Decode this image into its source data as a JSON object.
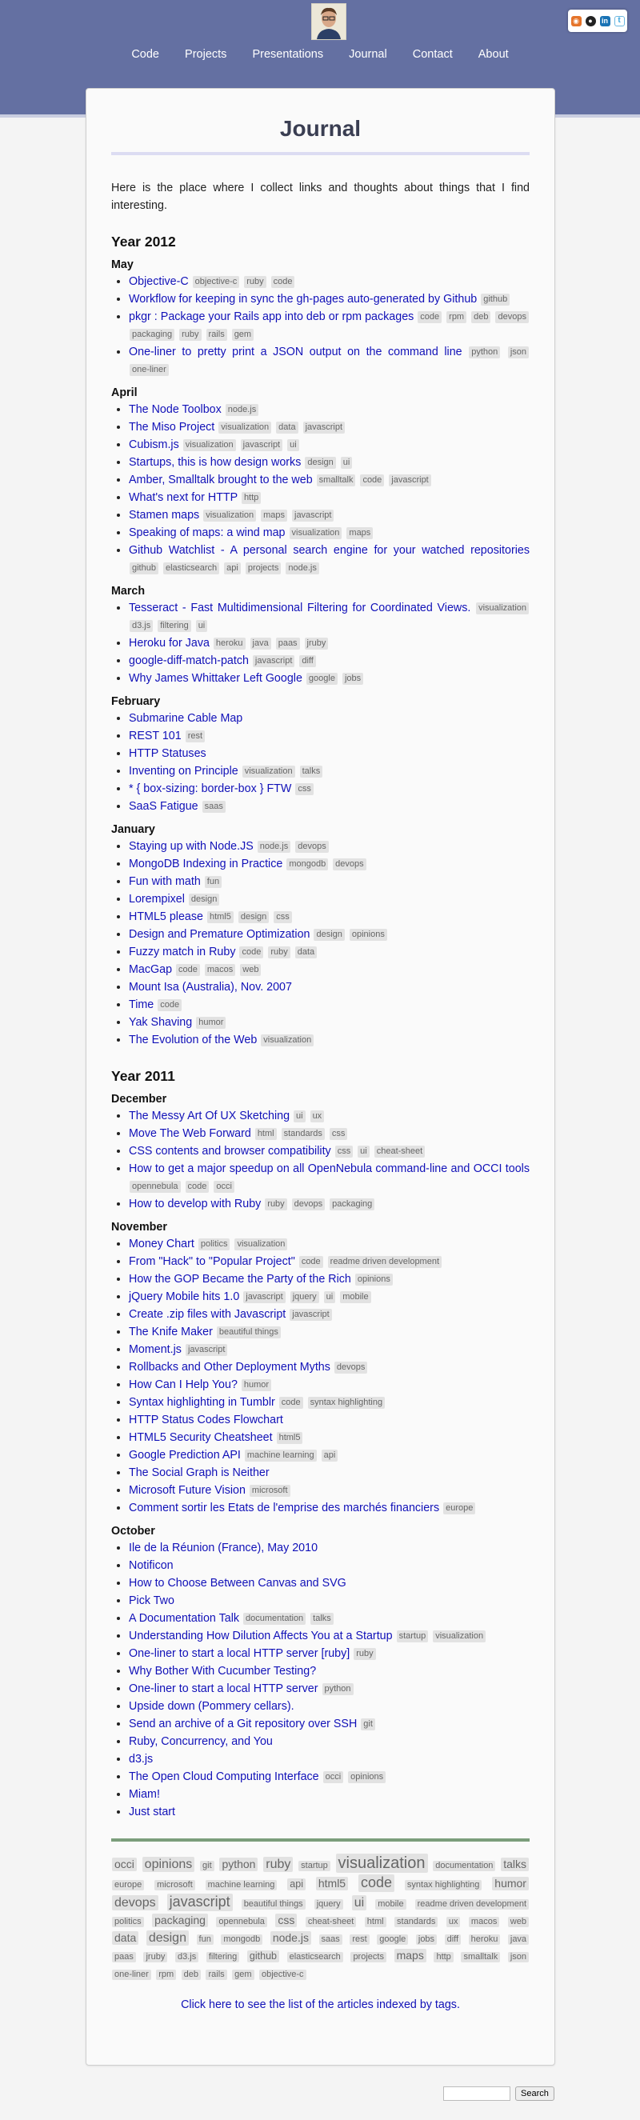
{
  "nav": [
    "Code",
    "Projects",
    "Presentations",
    "Journal",
    "Contact",
    "About"
  ],
  "social": [
    {
      "name": "rss-icon",
      "glyph": "◉"
    },
    {
      "name": "github-icon",
      "glyph": "●"
    },
    {
      "name": "linkedin-icon",
      "glyph": "in"
    },
    {
      "name": "twitter-icon",
      "glyph": "t"
    }
  ],
  "title": "Journal",
  "intro": "Here is the place where I collect links and thoughts about things that I find interesting.",
  "years": [
    {
      "label": "Year 2012",
      "months": [
        {
          "label": "May",
          "items": [
            {
              "t": "Objective-C",
              "tags": [
                "objective-c",
                "ruby",
                "code"
              ]
            },
            {
              "t": "Workflow for keeping in sync the gh-pages auto-generated by Github",
              "tags": [
                "github"
              ]
            },
            {
              "t": "pkgr : Package your Rails app into deb or rpm packages",
              "tags": [
                "code",
                "rpm",
                "deb",
                "devops",
                "packaging",
                "ruby",
                "rails",
                "gem"
              ]
            },
            {
              "t": "One-liner to pretty print a JSON output on the command line",
              "tags": [
                "python",
                "json",
                "one-liner"
              ]
            }
          ]
        },
        {
          "label": "April",
          "items": [
            {
              "t": "The Node Toolbox",
              "tags": [
                "node.js"
              ]
            },
            {
              "t": "The Miso Project",
              "tags": [
                "visualization",
                "data",
                "javascript"
              ]
            },
            {
              "t": "Cubism.js",
              "tags": [
                "visualization",
                "javascript",
                "ui"
              ]
            },
            {
              "t": "Startups, this is how design works",
              "tags": [
                "design",
                "ui"
              ]
            },
            {
              "t": "Amber, Smalltalk brought to the web",
              "tags": [
                "smalltalk",
                "code",
                "javascript"
              ]
            },
            {
              "t": "What's next for HTTP",
              "tags": [
                "http"
              ]
            },
            {
              "t": "Stamen maps",
              "tags": [
                "visualization",
                "maps",
                "javascript"
              ]
            },
            {
              "t": "Speaking of maps: a wind map",
              "tags": [
                "visualization",
                "maps"
              ]
            },
            {
              "t": "Github Watchlist - A personal search engine for your watched repositories",
              "tags": [
                "github",
                "elasticsearch",
                "api",
                "projects",
                "node.js"
              ]
            }
          ]
        },
        {
          "label": "March",
          "items": [
            {
              "t": "Tesseract - Fast Multidimensional Filtering for Coordinated Views.",
              "tags": [
                "visualization",
                "d3.js",
                "filtering",
                "ui"
              ]
            },
            {
              "t": "Heroku for Java",
              "tags": [
                "heroku",
                "java",
                "paas",
                "jruby"
              ]
            },
            {
              "t": "google-diff-match-patch",
              "tags": [
                "javascript",
                "diff"
              ]
            },
            {
              "t": "Why James Whittaker Left Google",
              "tags": [
                "google",
                "jobs"
              ]
            }
          ]
        },
        {
          "label": "February",
          "items": [
            {
              "t": "Submarine Cable Map",
              "tags": []
            },
            {
              "t": "REST 101",
              "tags": [
                "rest"
              ]
            },
            {
              "t": "HTTP Statuses",
              "tags": []
            },
            {
              "t": "Inventing on Principle",
              "tags": [
                "visualization",
                "talks"
              ]
            },
            {
              "t": "* { box-sizing: border-box } FTW",
              "tags": [
                "css"
              ]
            },
            {
              "t": "SaaS Fatigue",
              "tags": [
                "saas"
              ]
            }
          ]
        },
        {
          "label": "January",
          "items": [
            {
              "t": "Staying up with Node.JS",
              "tags": [
                "node.js",
                "devops"
              ]
            },
            {
              "t": "MongoDB Indexing in Practice",
              "tags": [
                "mongodb",
                "devops"
              ]
            },
            {
              "t": "Fun with math",
              "tags": [
                "fun"
              ]
            },
            {
              "t": "Lorempixel",
              "tags": [
                "design"
              ]
            },
            {
              "t": "HTML5 please",
              "tags": [
                "html5",
                "design",
                "css"
              ]
            },
            {
              "t": "Design and Premature Optimization",
              "tags": [
                "design",
                "opinions"
              ]
            },
            {
              "t": "Fuzzy match in Ruby",
              "tags": [
                "code",
                "ruby",
                "data"
              ]
            },
            {
              "t": "MacGap",
              "tags": [
                "code",
                "macos",
                "web"
              ]
            },
            {
              "t": "Mount Isa (Australia), Nov. 2007",
              "tags": []
            },
            {
              "t": "Time",
              "tags": [
                "code"
              ]
            },
            {
              "t": "Yak Shaving",
              "tags": [
                "humor"
              ]
            },
            {
              "t": "The Evolution of the Web",
              "tags": [
                "visualization"
              ]
            }
          ]
        }
      ]
    },
    {
      "label": "Year 2011",
      "months": [
        {
          "label": "December",
          "items": [
            {
              "t": "The Messy Art Of UX Sketching",
              "tags": [
                "ui",
                "ux"
              ]
            },
            {
              "t": "Move The Web Forward",
              "tags": [
                "html",
                "standards",
                "css"
              ]
            },
            {
              "t": "CSS contents and browser compatibility",
              "tags": [
                "css",
                "ui",
                "cheat-sheet"
              ]
            },
            {
              "t": "How to get a major speedup on all OpenNebula command-line and OCCI tools",
              "tags": [
                "opennebula",
                "code",
                "occi"
              ]
            },
            {
              "t": "How to develop with Ruby",
              "tags": [
                "ruby",
                "devops",
                "packaging"
              ]
            }
          ]
        },
        {
          "label": "November",
          "items": [
            {
              "t": "Money Chart",
              "tags": [
                "politics",
                "visualization"
              ]
            },
            {
              "t": "From \"Hack\" to \"Popular Project\"",
              "tags": [
                "code",
                "readme driven development"
              ]
            },
            {
              "t": "How the GOP Became the Party of the Rich",
              "tags": [
                "opinions"
              ]
            },
            {
              "t": "jQuery Mobile hits 1.0",
              "tags": [
                "javascript",
                "jquery",
                "ui",
                "mobile"
              ]
            },
            {
              "t": "Create .zip files with Javascript",
              "tags": [
                "javascript"
              ]
            },
            {
              "t": "The Knife Maker",
              "tags": [
                "beautiful things"
              ]
            },
            {
              "t": "Moment.js",
              "tags": [
                "javascript"
              ]
            },
            {
              "t": "Rollbacks and Other Deployment Myths",
              "tags": [
                "devops"
              ]
            },
            {
              "t": "How Can I Help You?",
              "tags": [
                "humor"
              ]
            },
            {
              "t": "Syntax highlighting in Tumblr",
              "tags": [
                "code",
                "syntax highlighting"
              ]
            },
            {
              "t": "HTTP Status Codes Flowchart",
              "tags": []
            },
            {
              "t": "HTML5 Security Cheatsheet",
              "tags": [
                "html5"
              ]
            },
            {
              "t": "Google Prediction API",
              "tags": [
                "machine learning",
                "api"
              ]
            },
            {
              "t": "The Social Graph is Neither",
              "tags": []
            },
            {
              "t": "Microsoft Future Vision",
              "tags": [
                "microsoft"
              ]
            },
            {
              "t": "Comment sortir les Etats de l'emprise des marchés financiers",
              "tags": [
                "europe"
              ]
            }
          ]
        },
        {
          "label": "October",
          "items": [
            {
              "t": "Ile de la Réunion (France), May 2010",
              "tags": []
            },
            {
              "t": "Notificon",
              "tags": []
            },
            {
              "t": "How to Choose Between Canvas and SVG",
              "tags": []
            },
            {
              "t": "Pick Two",
              "tags": []
            },
            {
              "t": "A Documentation Talk",
              "tags": [
                "documentation",
                "talks"
              ]
            },
            {
              "t": "Understanding How Dilution Affects You at a Startup",
              "tags": [
                "startup",
                "visualization"
              ]
            },
            {
              "t": "One-liner to start a local HTTP server [ruby]",
              "tags": [
                "ruby"
              ]
            },
            {
              "t": "Why Bother With Cucumber Testing?",
              "tags": []
            },
            {
              "t": "One-liner to start a local HTTP server",
              "tags": [
                "python"
              ]
            },
            {
              "t": "Upside down (Pommery cellars).",
              "tags": []
            },
            {
              "t": "Send an archive of a Git repository over SSH",
              "tags": [
                "git"
              ]
            },
            {
              "t": "Ruby, Concurrency, and You",
              "tags": []
            },
            {
              "t": "d3.js",
              "tags": []
            },
            {
              "t": "The Open Cloud Computing Interface",
              "tags": [
                "occi",
                "opinions"
              ]
            },
            {
              "t": "Miam!",
              "tags": []
            },
            {
              "t": "Just start",
              "tags": []
            }
          ]
        }
      ]
    }
  ],
  "tag_cloud": [
    {
      "t": "occi",
      "s": 3
    },
    {
      "t": "opinions",
      "s": 4
    },
    {
      "t": "git",
      "s": 1
    },
    {
      "t": "python",
      "s": 3
    },
    {
      "t": "ruby",
      "s": 4
    },
    {
      "t": "startup",
      "s": 1
    },
    {
      "t": "visualization",
      "s": 6
    },
    {
      "t": "documentation",
      "s": 1
    },
    {
      "t": "talks",
      "s": 3
    },
    {
      "t": "europe",
      "s": 1
    },
    {
      "t": "microsoft",
      "s": 1
    },
    {
      "t": "machine learning",
      "s": 1
    },
    {
      "t": "api",
      "s": 2
    },
    {
      "t": "html5",
      "s": 3
    },
    {
      "t": "code",
      "s": 5
    },
    {
      "t": "syntax highlighting",
      "s": 1
    },
    {
      "t": "humor",
      "s": 3
    },
    {
      "t": "devops",
      "s": 4
    },
    {
      "t": "javascript",
      "s": 5
    },
    {
      "t": "beautiful things",
      "s": 1
    },
    {
      "t": "jquery",
      "s": 1
    },
    {
      "t": "ui",
      "s": 4
    },
    {
      "t": "mobile",
      "s": 1
    },
    {
      "t": "readme driven development",
      "s": 1
    },
    {
      "t": "politics",
      "s": 1
    },
    {
      "t": "packaging",
      "s": 3
    },
    {
      "t": "opennebula",
      "s": 1
    },
    {
      "t": "css",
      "s": 3
    },
    {
      "t": "cheat-sheet",
      "s": 1
    },
    {
      "t": "html",
      "s": 1
    },
    {
      "t": "standards",
      "s": 1
    },
    {
      "t": "ux",
      "s": 1
    },
    {
      "t": "macos",
      "s": 1
    },
    {
      "t": "web",
      "s": 1
    },
    {
      "t": "data",
      "s": 3
    },
    {
      "t": "design",
      "s": 4
    },
    {
      "t": "fun",
      "s": 1
    },
    {
      "t": "mongodb",
      "s": 1
    },
    {
      "t": "node.js",
      "s": 3
    },
    {
      "t": "saas",
      "s": 1
    },
    {
      "t": "rest",
      "s": 1
    },
    {
      "t": "google",
      "s": 1
    },
    {
      "t": "jobs",
      "s": 1
    },
    {
      "t": "diff",
      "s": 1
    },
    {
      "t": "heroku",
      "s": 1
    },
    {
      "t": "java",
      "s": 1
    },
    {
      "t": "paas",
      "s": 1
    },
    {
      "t": "jruby",
      "s": 1
    },
    {
      "t": "d3.js",
      "s": 1
    },
    {
      "t": "filtering",
      "s": 1
    },
    {
      "t": "github",
      "s": 2
    },
    {
      "t": "elasticsearch",
      "s": 1
    },
    {
      "t": "projects",
      "s": 1
    },
    {
      "t": "maps",
      "s": 3
    },
    {
      "t": "http",
      "s": 1
    },
    {
      "t": "smalltalk",
      "s": 1
    },
    {
      "t": "json",
      "s": 1
    },
    {
      "t": "one-liner",
      "s": 1
    },
    {
      "t": "rpm",
      "s": 1
    },
    {
      "t": "deb",
      "s": 1
    },
    {
      "t": "rails",
      "s": 1
    },
    {
      "t": "gem",
      "s": 1
    },
    {
      "t": "objective-c",
      "s": 1
    }
  ],
  "tags_link": "Click here to see the list of the articles indexed by tags.",
  "search": {
    "placeholder": "",
    "button": "Search"
  },
  "colors": {
    "header": "#6470a2",
    "link": "#1111b8",
    "rule_top": "#dcdcf2",
    "rule_bottom": "#7b9e7b"
  }
}
